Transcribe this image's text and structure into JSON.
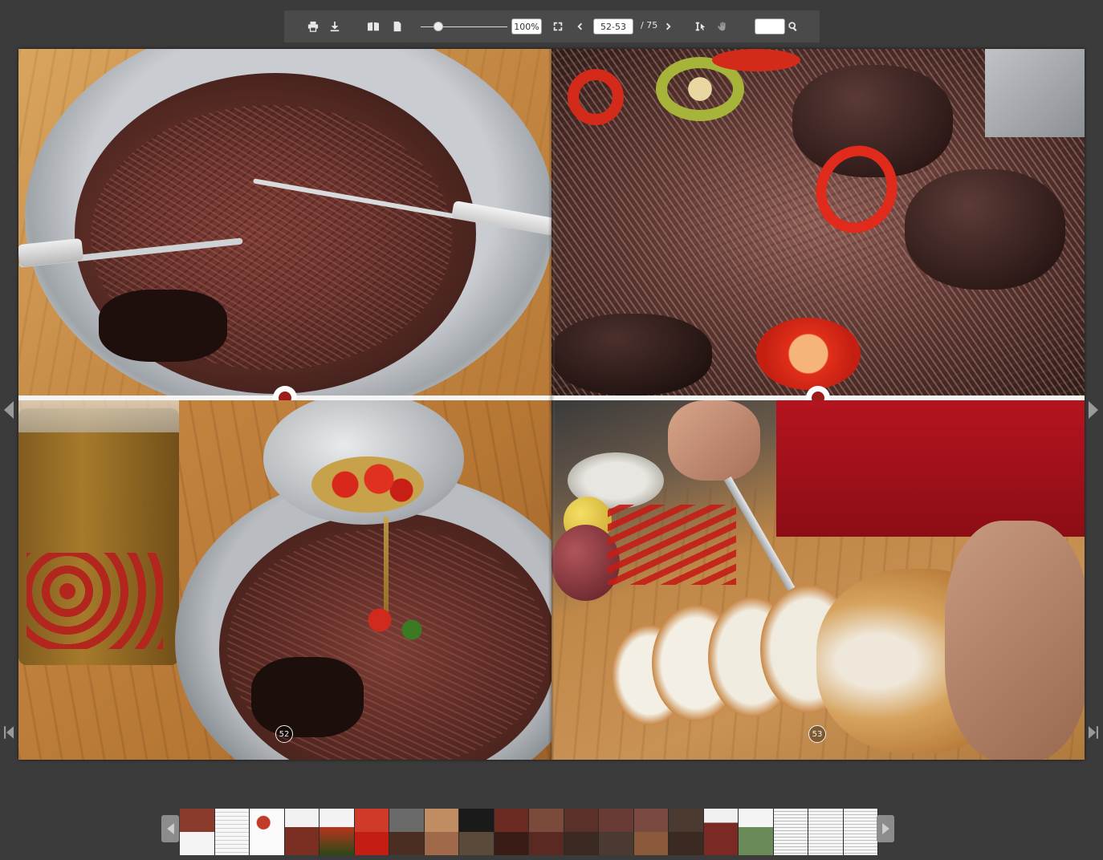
{
  "toolbar": {
    "zoom_value": "100%",
    "page_range": "52-53",
    "page_total": "/ 75",
    "search_placeholder": "",
    "zoom_level": 0.2
  },
  "book": {
    "left_page_number": "52",
    "right_page_number": "53"
  },
  "thumbnails": {
    "count": 20
  }
}
